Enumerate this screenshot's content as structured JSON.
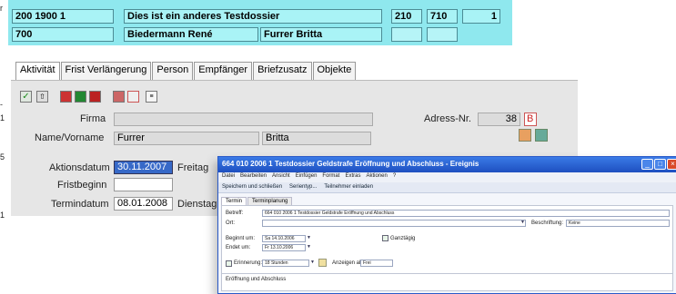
{
  "header": {
    "row1": {
      "number": "200 1900 1",
      "title": "Dies ist ein anderes Testdossier",
      "code1": "210",
      "code2": "710",
      "count": "1"
    },
    "row2": {
      "code": "700",
      "person1": "Biedermann René",
      "person2": "Furrer Britta"
    },
    "left_marks": [
      "r",
      "-",
      "1",
      "5",
      "1"
    ]
  },
  "tabs": [
    "Aktivität",
    "Frist Verlängerung",
    "Person",
    "Empfänger",
    "Briefzusatz",
    "Objekte"
  ],
  "form": {
    "firma_label": "Firma",
    "firma_value": "",
    "adress_label": "Adress-Nr.",
    "adress_value": "38",
    "adress_flag": "B",
    "name_label": "Name/Vorname",
    "name_value": "Furrer",
    "vorname_value": "Britta",
    "aktionsdatum_label": "Aktionsdatum",
    "aktionsdatum_value": "30.11.2007",
    "aktionsdatum_day": "Freitag",
    "fristbeginn_label": "Fristbeginn",
    "fristbeginn_value": "",
    "termindatum_label": "Termindatum",
    "termindatum_value": "08.01.2008",
    "termindatum_day": "Dienstag"
  },
  "dialog": {
    "title": "664 010 2006 1 Testdossier Geldstrafe Eröffnung und Abschluss - Ereignis",
    "menu": [
      "Datei",
      "Bearbeiten",
      "Ansicht",
      "Einfügen",
      "Format",
      "Extras",
      "Aktionen",
      "?"
    ],
    "toolbar": [
      "Speichern und schließen",
      "Serientyp...",
      "Teilnehmer einladen"
    ],
    "tabs": [
      "Termin",
      "Terminplanung"
    ],
    "betreff_label": "Betreff:",
    "betreff_value": "664 010 2006 1 Testdossier Geldstrafe Eröffnung und Abschluss",
    "ort_label": "Ort:",
    "beschriftung_label": "Beschriftung:",
    "beschriftung_value": "Keine",
    "beginn_label": "Beginnt um:",
    "beginn_value": "Sa 14.10.2006",
    "ende_label": "Endet um:",
    "ende_value": "Fr 13.10.2006",
    "ganztag_label": "Ganztägig",
    "erinnerung_label": "Erinnerung:",
    "erinnerung_value": "18 Stunden",
    "anzeigen_label": "Anzeigen als:",
    "anzeigen_value": "Frei",
    "body_text": "Eröffnung und Abschluss"
  }
}
